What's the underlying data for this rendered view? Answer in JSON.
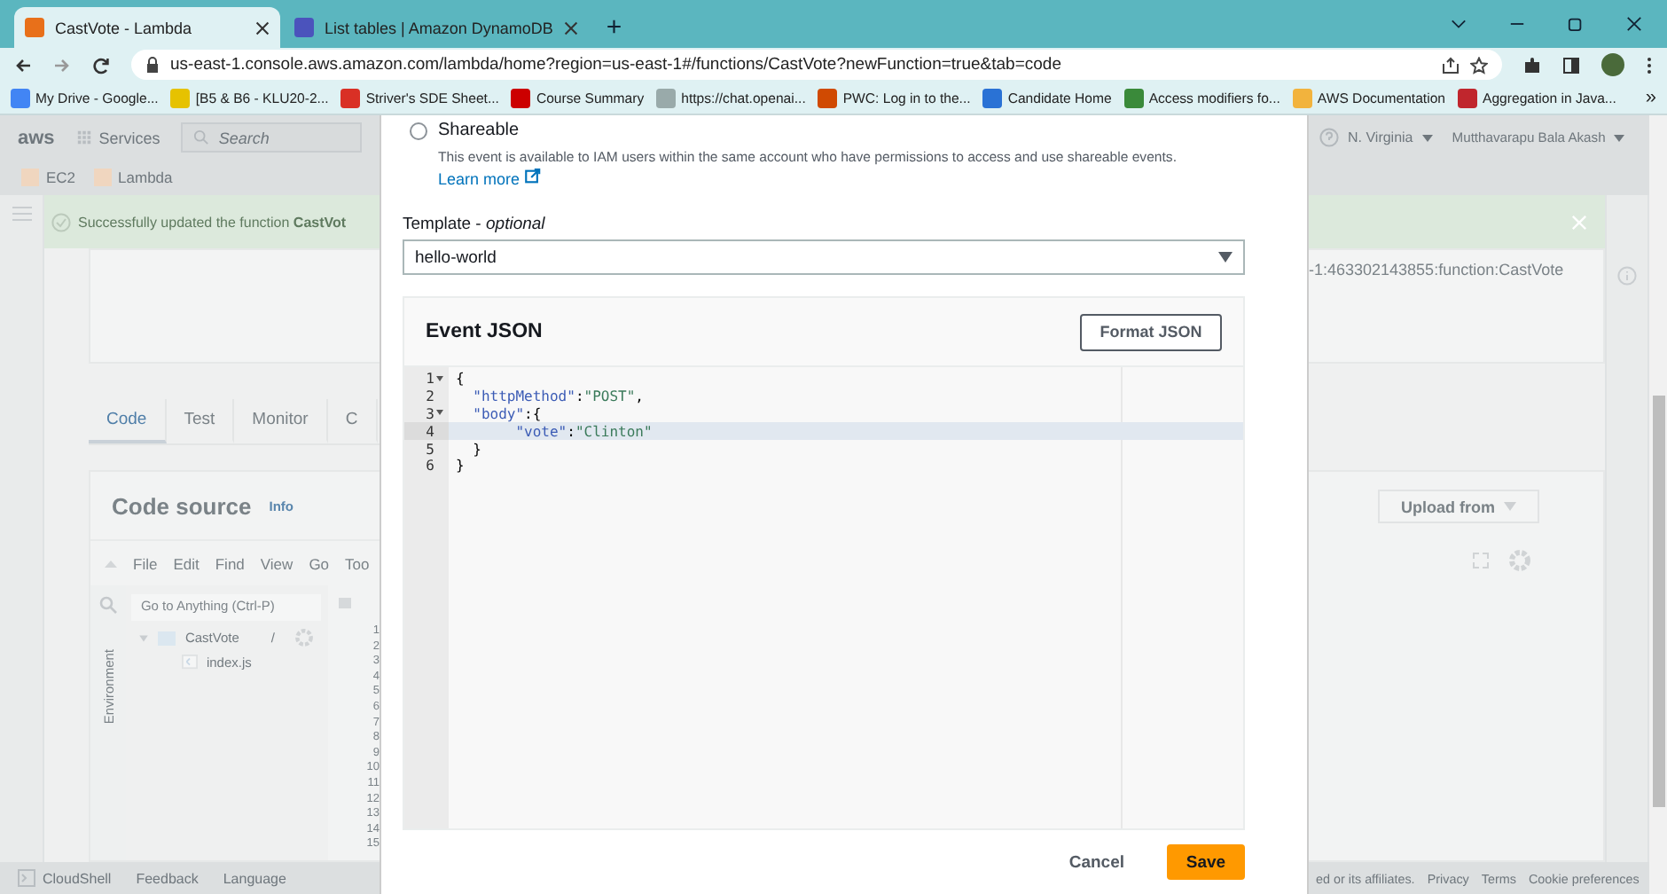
{
  "browser": {
    "tabs": [
      {
        "title": "CastVote - Lambda",
        "selected": true
      },
      {
        "title": "List tables | Amazon DynamoDB",
        "selected": false
      }
    ],
    "new_tab": "+",
    "url": "us-east-1.console.aws.amazon.com/lambda/home?region=us-east-1#/functions/CastVote?newFunction=true&tab=code",
    "bookmarks": [
      "My Drive - Google...",
      "[B5 & B6 - KLU20-2...",
      "Striver's SDE Sheet...",
      "Course Summary",
      "https://chat.openai...",
      "PWC: Log in to the...",
      "Candidate Home",
      "Access modifiers fo...",
      "AWS Documentation",
      "Aggregation in Java..."
    ],
    "more_bookmarks": "»"
  },
  "console": {
    "nav": {
      "logo": "aws",
      "services": "Services",
      "search_placeholder": "Search",
      "region": "N. Virginia",
      "user": "Mutthavarapu Bala Akash"
    },
    "breadcrumbs": [
      "EC2",
      "Lambda"
    ],
    "flash": {
      "message": "Successfully updated the function **CastVot**"
    },
    "arn": "-1:463302143855:function:CastVote",
    "tabs": [
      {
        "label": "Code",
        "selected": true
      },
      {
        "label": "Test",
        "selected": false
      },
      {
        "label": "Monitor",
        "selected": false
      },
      {
        "label": "C",
        "selected": false
      }
    ],
    "code_source": {
      "title": "Code source",
      "info": "Info",
      "upload": "Upload from",
      "menu": [
        "File",
        "Edit",
        "Find",
        "View",
        "Go",
        "Too"
      ],
      "search_placeholder": "Go to Anything (Ctrl-P)",
      "environment": "Environment",
      "tree": [
        {
          "name": "CastVote",
          "suffix": "/",
          "kind": "folder",
          "expanded": true,
          "children": [
            {
              "name": "index.js",
              "kind": "file"
            }
          ]
        }
      ],
      "line_numbers": [
        "1",
        "2",
        "3",
        "4",
        "5",
        "6",
        "7",
        "8",
        "9",
        "10",
        "11",
        "12",
        "13",
        "14",
        "15"
      ]
    },
    "footer": {
      "left": [
        "CloudShell",
        "Feedback",
        "Language"
      ],
      "copyright": "ed or its affiliates.",
      "links": [
        "Privacy",
        "Terms",
        "Cookie preferences"
      ]
    }
  },
  "modal": {
    "shareable": {
      "label": "Shareable",
      "selected": false,
      "description": "This event is available to IAM users within the same account who have permissions to access and use shareable events.",
      "link": "Learn more"
    },
    "template": {
      "label": "Template - *optional*",
      "value": "hello-world"
    },
    "event_json": {
      "title": "Event JSON",
      "format_button": "Format JSON",
      "lines": [
        {
          "number": "1",
          "text": "{",
          "foldable": true,
          "active": false
        },
        {
          "number": "2",
          "text": "  \"httpMethod\":\"POST\",",
          "foldable": false,
          "active": false
        },
        {
          "number": "3",
          "text": "  \"body\":{",
          "foldable": true,
          "active": false
        },
        {
          "number": "4",
          "text": "       \"vote\":\"Clinton\"",
          "foldable": false,
          "active": true
        },
        {
          "number": "5",
          "text": "  }",
          "foldable": false,
          "active": false
        },
        {
          "number": "6",
          "text": "}",
          "foldable": false,
          "active": false
        }
      ]
    },
    "buttons": {
      "cancel": "Cancel",
      "save": "Save"
    }
  }
}
